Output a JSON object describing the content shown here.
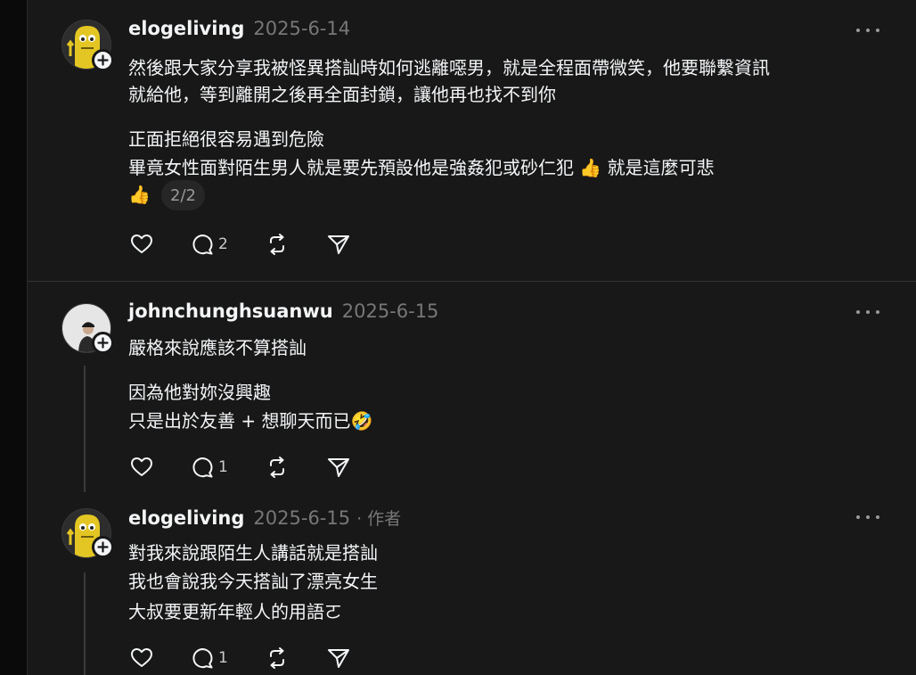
{
  "colors": {
    "background": "#0a0a0a",
    "panel": "#181818",
    "text_primary": "#f3f5f7",
    "text_secondary": "#777777",
    "divider": "#343434",
    "avatar_yellow": "#e3c623"
  },
  "thread": {
    "posts": [
      {
        "username": "elogeliving",
        "date": "2025-6-14",
        "lines": [
          "然後跟大家分享我被怪異搭訕時如何逃離噁男，就是全程面帶微笑，他要聯繫資訊",
          "就給他，等到離開之後再全面封鎖，讓他再也找不到你",
          "正面拒絕很容易遇到危險",
          "畢竟女性面對陌生男人就是要先預設他是強姦犯或砂仁犯 👍 就是這麼可悲",
          "👍"
        ],
        "page_indicator": "2/2",
        "reply_count": "2",
        "avatar_icon": "mascot-avatar-icon"
      },
      {
        "username": "johnchunghsuanwu",
        "date": "2025-6-15",
        "lines": [
          "嚴格來說應該不算搭訕",
          "因為他對妳沒興趣",
          "只是出於友善 + 想聊天而已🤣"
        ],
        "reply_count": "1",
        "avatar_icon": "person-photo-avatar-icon"
      },
      {
        "username": "elogeliving",
        "date": "2025-6-15",
        "author_separator": "·",
        "author_tag": "作者",
        "lines": [
          "對我來說跟陌生人講話就是搭訕",
          "我也會說我今天搭訕了漂亮女生",
          "大叔要更新年輕人的用語ㄛ"
        ],
        "reply_count": "1",
        "avatar_icon": "mascot-avatar-icon"
      }
    ]
  },
  "icons": {
    "like": "heart-icon",
    "reply": "reply-bubble-icon",
    "repost": "repost-icon",
    "share": "send-icon",
    "more": "more-icon",
    "follow": "plus-icon"
  }
}
